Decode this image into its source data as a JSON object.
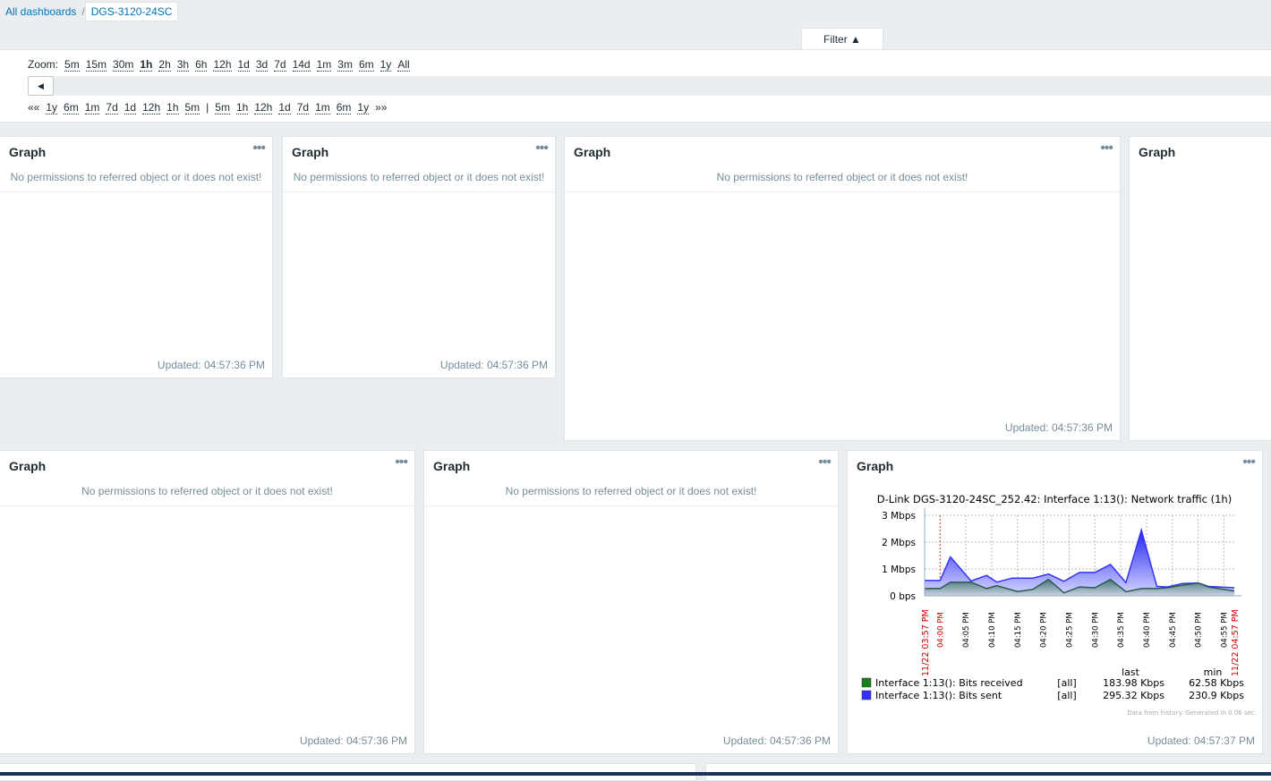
{
  "breadcrumb": {
    "all": "All dashboards",
    "sep": "/",
    "current": "DGS-3120-24SC"
  },
  "filter": {
    "label": "Filter ▲"
  },
  "zoom": {
    "label": "Zoom:",
    "options": [
      "5m",
      "15m",
      "30m",
      "1h",
      "2h",
      "3h",
      "6h",
      "12h",
      "1d",
      "3d",
      "7d",
      "14d",
      "1m",
      "3m",
      "6m",
      "1y",
      "All"
    ],
    "selected": "1h"
  },
  "nav": {
    "back": "««",
    "items_back": [
      "1y",
      "6m",
      "1m",
      "7d",
      "1d",
      "12h",
      "1h",
      "5m"
    ],
    "divider": "|",
    "items_fwd": [
      "5m",
      "1h",
      "12h",
      "1d",
      "7d",
      "1m",
      "6m",
      "1y"
    ],
    "fwd": "»»",
    "prev_icon": "triangle-left-icon"
  },
  "widgets": [
    {
      "title": "Graph",
      "message": "No permissions to referred object or it does not exist!",
      "updated": "Updated: 04:57:36 PM"
    },
    {
      "title": "Graph",
      "message": "No permissions to referred object or it does not exist!",
      "updated": "Updated: 04:57:36 PM"
    },
    {
      "title": "Graph",
      "message": "No permissions to referred object or it does not exist!",
      "updated": "Updated: 04:57:36 PM"
    },
    {
      "title": "Graph"
    },
    {
      "title": "Graph",
      "message": "No permissions to referred object or it does not exist!",
      "updated": "Updated: 04:57:36 PM"
    },
    {
      "title": "Graph",
      "message": "No permissions to referred object or it does not exist!",
      "updated": "Updated: 04:57:36 PM"
    },
    {
      "title": "Graph",
      "updated": "Updated: 04:57:37 PM"
    }
  ],
  "chart_data": {
    "type": "area",
    "title": "D-Link DGS-3120-24SC_252.42: Interface 1:13(): Network traffic (1h)",
    "y_ticks": [
      "3 Mbps",
      "2 Mbps",
      "1 Mbps",
      "0 bps"
    ],
    "ylim": [
      0,
      3
    ],
    "x_ticks": [
      "04:00 PM",
      "04:05 PM",
      "04:10 PM",
      "04:15 PM",
      "04:20 PM",
      "04:25 PM",
      "04:30 PM",
      "04:35 PM",
      "04:40 PM",
      "04:45 PM",
      "04:50 PM",
      "04:55 PM"
    ],
    "x_start": "11/22 03:57 PM",
    "x_end": "11/22 04:57 PM",
    "grid": true,
    "series": [
      {
        "name": "Interface 1:13(): Bits sent",
        "color": "#3333ff",
        "func": "[all]",
        "last": "295.32 Kbps",
        "min": "230.9 Kbps",
        "points": [
          [
            "03:57",
            0.57
          ],
          [
            "04:00",
            0.57
          ],
          [
            "04:02",
            1.45
          ],
          [
            "04:06",
            0.55
          ],
          [
            "04:09",
            0.76
          ],
          [
            "04:11",
            0.51
          ],
          [
            "04:14",
            0.66
          ],
          [
            "04:18",
            0.66
          ],
          [
            "04:21",
            0.81
          ],
          [
            "04:24",
            0.54
          ],
          [
            "04:27",
            0.87
          ],
          [
            "04:30",
            0.87
          ],
          [
            "04:33",
            1.17
          ],
          [
            "04:36",
            0.49
          ],
          [
            "04:39",
            2.45
          ],
          [
            "04:42",
            0.35
          ],
          [
            "04:44",
            0.33
          ],
          [
            "04:47",
            0.46
          ],
          [
            "04:50",
            0.48
          ],
          [
            "04:52",
            0.35
          ],
          [
            "04:57",
            0.3
          ]
        ]
      },
      {
        "name": "Interface 1:13(): Bits received",
        "color": "#1a7c1a",
        "func": "[all]",
        "last": "183.98 Kbps",
        "min": "62.58 Kbps",
        "points": [
          [
            "03:57",
            0.27
          ],
          [
            "04:00",
            0.27
          ],
          [
            "04:02",
            0.51
          ],
          [
            "04:06",
            0.51
          ],
          [
            "04:09",
            0.27
          ],
          [
            "04:11",
            0.38
          ],
          [
            "04:15",
            0.16
          ],
          [
            "04:18",
            0.24
          ],
          [
            "04:21",
            0.61
          ],
          [
            "04:24",
            0.11
          ],
          [
            "04:27",
            0.33
          ],
          [
            "04:30",
            0.3
          ],
          [
            "04:33",
            0.61
          ],
          [
            "04:36",
            0.15
          ],
          [
            "04:39",
            0.27
          ],
          [
            "04:42",
            0.27
          ],
          [
            "04:44",
            0.3
          ],
          [
            "04:47",
            0.4
          ],
          [
            "04:50",
            0.48
          ],
          [
            "04:52",
            0.33
          ],
          [
            "04:57",
            0.18
          ]
        ]
      }
    ],
    "legend_headers": [
      "last",
      "min"
    ],
    "footer": "Data from history. Generated in 0.06 sec."
  }
}
